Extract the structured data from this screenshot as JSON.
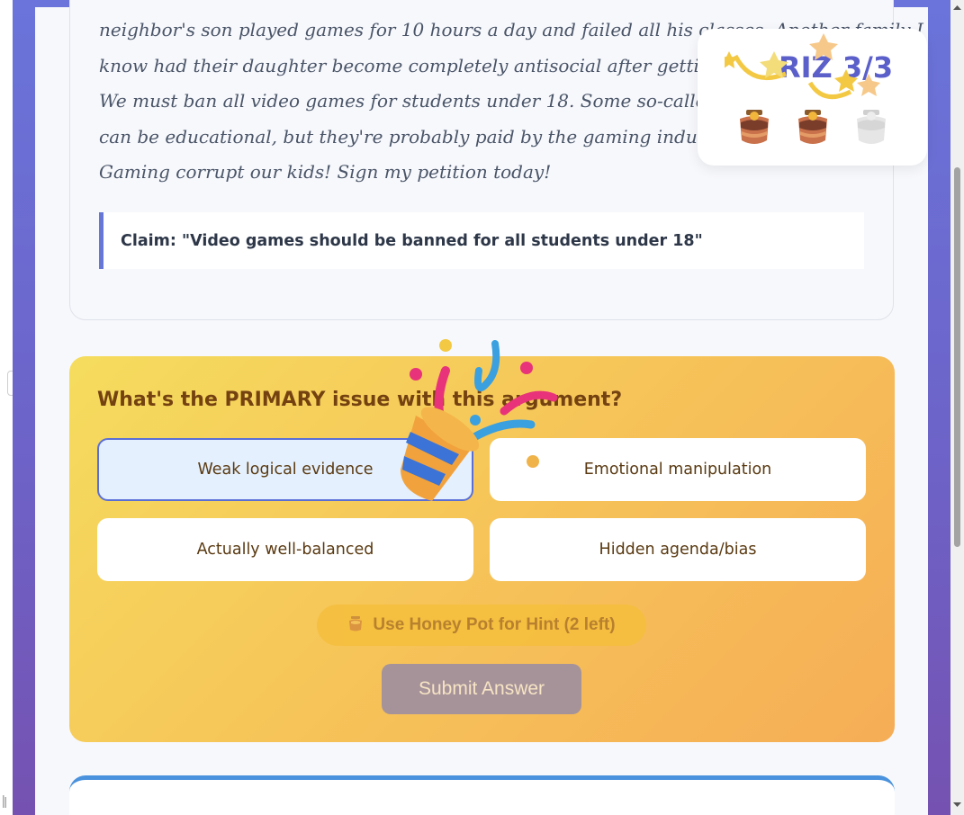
{
  "argument": {
    "lines": [
      "neighbor's son played games for 10 hours a day and failed all his classes. Another family I",
      "know had their daughter become completely antisocial after getting a",
      "We must ban all video games for students under 18. Some so-called ex",
      "can be educational, but they're probably paid by the gaming industry.",
      "Gaming corrupt our kids! Sign my petition today!"
    ],
    "claim": "Claim: \"Video games should be banned for all students under 18\""
  },
  "question": {
    "title": "What's the PRIMARY issue with this argument?",
    "options": [
      {
        "label": "Weak logical evidence",
        "selected": true
      },
      {
        "label": "Emotional manipulation",
        "selected": false
      },
      {
        "label": "Actually well-balanced",
        "selected": false
      },
      {
        "label": "Hidden agenda/bias",
        "selected": false
      }
    ],
    "hint_icon": "honey-pot-icon",
    "hint_label": "Use Honey Pot for Hint (2 left)",
    "submit_label": "Submit Answer"
  },
  "score": {
    "text": "RIZ 3/3",
    "pots": [
      {
        "state": "filled"
      },
      {
        "state": "filled"
      },
      {
        "state": "empty"
      }
    ]
  },
  "colors": {
    "accent": "#5b5fc9",
    "panel_gradient_start": "#f5dc5e",
    "panel_gradient_end": "#f6ad56",
    "selected_border": "#5a6fd6",
    "claim_border": "#6677d6"
  }
}
